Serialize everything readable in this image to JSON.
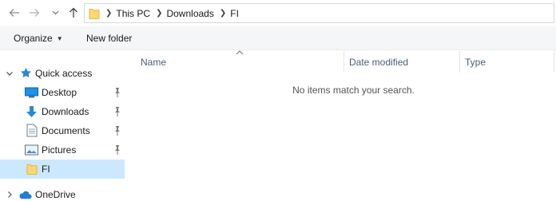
{
  "address": {
    "crumbs": [
      "This PC",
      "Downloads",
      "FI"
    ]
  },
  "commands": {
    "organize_label": "Organize",
    "new_folder_label": "New folder"
  },
  "navigation": {
    "quick_access_label": "Quick access",
    "items": [
      {
        "label": "Desktop",
        "icon": "desktop-icon",
        "pinned": true
      },
      {
        "label": "Downloads",
        "icon": "download-arrow-icon",
        "pinned": true
      },
      {
        "label": "Documents",
        "icon": "documents-icon",
        "pinned": true
      },
      {
        "label": "Pictures",
        "icon": "pictures-icon",
        "pinned": true
      },
      {
        "label": "FI",
        "icon": "folder-icon",
        "pinned": false,
        "selected": true
      }
    ],
    "onedrive_label": "OneDrive"
  },
  "columns": {
    "name": "Name",
    "date_modified": "Date modified",
    "type": "Type"
  },
  "content": {
    "empty_message": "No items match your search."
  },
  "colors": {
    "selection": "#cce8ff",
    "accent": "#0078d7",
    "folder": "#ffd86b",
    "column_header_text": "#4c607a"
  }
}
